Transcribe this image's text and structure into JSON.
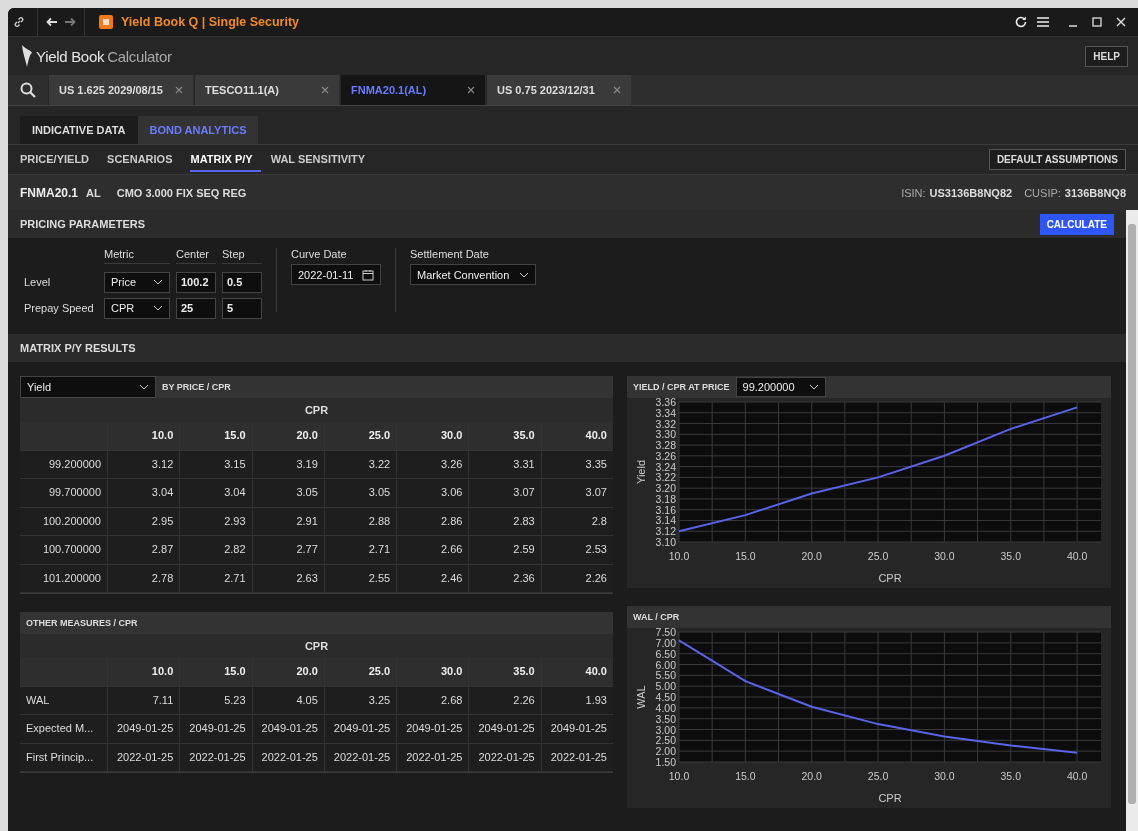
{
  "window": {
    "title": "Yield Book Q | Single Security"
  },
  "app": {
    "logo": "Yield Book",
    "logo_suffix": "Calculator",
    "help": "HELP"
  },
  "doc_tabs": [
    {
      "label": "US 1.625 2029/08/15",
      "selected": false
    },
    {
      "label": "TESCO11.1(A)",
      "selected": false
    },
    {
      "label": "FNMA20.1(AL)",
      "selected": true
    },
    {
      "label": "US 0.75 2023/12/31",
      "selected": false
    }
  ],
  "section_tabs": [
    {
      "label": "INDICATIVE DATA",
      "selected": false
    },
    {
      "label": "BOND ANALYTICS",
      "selected": true
    }
  ],
  "sub_tabs": [
    {
      "label": "PRICE/YIELD",
      "selected": false
    },
    {
      "label": "SCENARIOS",
      "selected": false
    },
    {
      "label": "MATRIX P/Y",
      "selected": true
    },
    {
      "label": "WAL SENSITIVITY",
      "selected": false
    }
  ],
  "default_assumptions": "DEFAULT ASSUMPTIONS",
  "security": {
    "name": "FNMA20.1",
    "type": "AL",
    "description": "CMO 3.000 FIX SEQ REG",
    "isin_label": "ISIN:",
    "isin": "US3136B8NQ82",
    "cusip_label": "CUSIP:",
    "cusip": "3136B8NQ8"
  },
  "pricing": {
    "title": "PRICING PARAMETERS",
    "calculate": "CALCULATE",
    "headers": [
      "Metric",
      "Center",
      "Step"
    ],
    "rows": [
      {
        "label": "Level",
        "metric": "Price",
        "center": "100.2",
        "step": "0.5"
      },
      {
        "label": "Prepay Speed",
        "metric": "CPR",
        "center": "25",
        "step": "5"
      }
    ],
    "curve_date": {
      "label": "Curve Date",
      "value": "2022-01-11"
    },
    "settlement_date": {
      "label": "Settlement Date",
      "value": "Market Convention"
    }
  },
  "results": {
    "title": "MATRIX P/Y RESULTS",
    "matrix": {
      "measure": "Yield",
      "title": "BY PRICE / CPR",
      "group": "CPR",
      "columns": [
        "10.0",
        "15.0",
        "20.0",
        "25.0",
        "30.0",
        "35.0",
        "40.0"
      ],
      "rows": [
        {
          "label": "99.200000",
          "values": [
            "3.12",
            "3.15",
            "3.19",
            "3.22",
            "3.26",
            "3.31",
            "3.35"
          ]
        },
        {
          "label": "99.700000",
          "values": [
            "3.04",
            "3.04",
            "3.05",
            "3.05",
            "3.06",
            "3.07",
            "3.07"
          ]
        },
        {
          "label": "100.200000",
          "values": [
            "2.95",
            "2.93",
            "2.91",
            "2.88",
            "2.86",
            "2.83",
            "2.8"
          ]
        },
        {
          "label": "100.700000",
          "values": [
            "2.87",
            "2.82",
            "2.77",
            "2.71",
            "2.66",
            "2.59",
            "2.53"
          ]
        },
        {
          "label": "101.200000",
          "values": [
            "2.78",
            "2.71",
            "2.63",
            "2.55",
            "2.46",
            "2.36",
            "2.26"
          ]
        }
      ]
    },
    "yield_chart": {
      "title": "YIELD / CPR AT PRICE",
      "price": "99.200000",
      "chart_data": {
        "type": "line",
        "grid": true,
        "xlabel": "CPR",
        "ylabel": "Yield",
        "categories": [
          "10.0",
          "15.0",
          "20.0",
          "25.0",
          "30.0",
          "35.0",
          "40.0"
        ],
        "series": [
          {
            "color": "#5b63e8",
            "values": [
              3.12,
              3.15,
              3.19,
              3.22,
              3.26,
              3.31,
              3.35
            ]
          }
        ],
        "ylim": [
          3.1,
          3.36
        ],
        "yticks": [
          {
            "value": 3.1,
            "label": "3.10"
          },
          {
            "value": 3.12,
            "label": "3.12"
          },
          {
            "value": 3.14,
            "label": "3.14"
          },
          {
            "value": 3.16,
            "label": "3.16"
          },
          {
            "value": 3.18,
            "label": "3.18"
          },
          {
            "value": 3.2,
            "label": "3.20"
          },
          {
            "value": 3.22,
            "label": "3.22"
          },
          {
            "value": 3.24,
            "label": "3.24"
          },
          {
            "value": 3.26,
            "label": "3.26"
          },
          {
            "value": 3.28,
            "label": "3.28"
          },
          {
            "value": 3.3,
            "label": "3.30"
          },
          {
            "value": 3.32,
            "label": "3.32"
          },
          {
            "value": 3.34,
            "label": "3.34"
          },
          {
            "value": 3.36,
            "label": "3.36"
          }
        ]
      }
    },
    "other": {
      "title": "OTHER MEASURES / CPR",
      "group": "CPR",
      "columns": [
        "10.0",
        "15.0",
        "20.0",
        "25.0",
        "30.0",
        "35.0",
        "40.0"
      ],
      "rows": [
        {
          "label": "WAL",
          "values": [
            "7.11",
            "5.23",
            "4.05",
            "3.25",
            "2.68",
            "2.26",
            "1.93"
          ]
        },
        {
          "label": "Expected M...",
          "values": [
            "2049-01-25",
            "2049-01-25",
            "2049-01-25",
            "2049-01-25",
            "2049-01-25",
            "2049-01-25",
            "2049-01-25"
          ]
        },
        {
          "label": "First Princip...",
          "values": [
            "2022-01-25",
            "2022-01-25",
            "2022-01-25",
            "2022-01-25",
            "2022-01-25",
            "2022-01-25",
            "2022-01-25"
          ]
        }
      ]
    },
    "wal_chart": {
      "title": "WAL / CPR",
      "chart_data": {
        "type": "line",
        "grid": true,
        "xlabel": "CPR",
        "ylabel": "WAL",
        "categories": [
          "10.0",
          "15.0",
          "20.0",
          "25.0",
          "30.0",
          "35.0",
          "40.0"
        ],
        "series": [
          {
            "color": "#5b63e8",
            "values": [
              7.11,
              5.23,
              4.05,
              3.25,
              2.68,
              2.26,
              1.93
            ]
          }
        ],
        "ylim": [
          1.5,
          7.5
        ],
        "yticks": [
          {
            "value": 1.5,
            "label": "1.50"
          },
          {
            "value": 2.0,
            "label": "2.00"
          },
          {
            "value": 2.5,
            "label": "2.50"
          },
          {
            "value": 3.0,
            "label": "3.00"
          },
          {
            "value": 3.5,
            "label": "3.50"
          },
          {
            "value": 4.0,
            "label": "4.00"
          },
          {
            "value": 4.5,
            "label": "4.50"
          },
          {
            "value": 5.0,
            "label": "5.00"
          },
          {
            "value": 5.5,
            "label": "5.50"
          },
          {
            "value": 6.0,
            "label": "6.00"
          },
          {
            "value": 6.5,
            "label": "6.50"
          },
          {
            "value": 7.0,
            "label": "7.00"
          },
          {
            "value": 7.5,
            "label": "7.50"
          }
        ]
      }
    }
  }
}
